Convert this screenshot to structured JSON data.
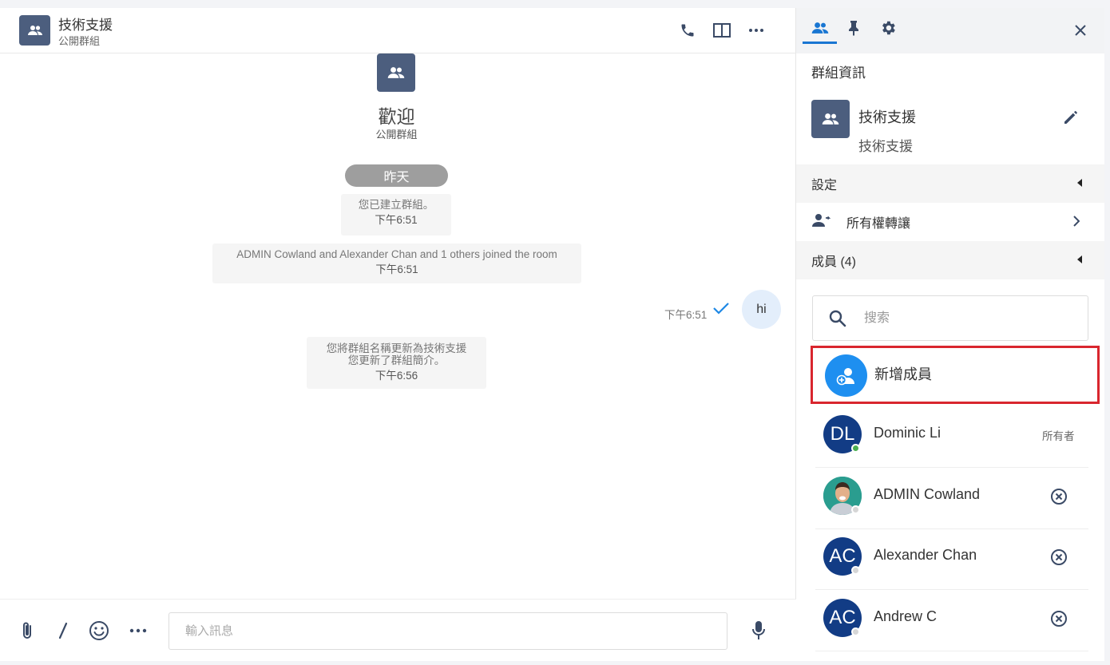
{
  "chat": {
    "header": {
      "title": "技術支援",
      "subtitle": "公開群組",
      "icons": [
        "phone-icon",
        "split-view-icon",
        "more-horizontal-icon"
      ]
    },
    "welcome": {
      "title": "歡迎",
      "subtitle": "公開群組"
    },
    "date_separator": "昨天",
    "system_messages": [
      {
        "lines": [
          "您已建立群組。"
        ],
        "time": "下午6:51"
      },
      {
        "lines": [
          "ADMIN Cowland and Alexander Chan and 1 others joined the room"
        ],
        "time": "下午6:51"
      },
      {
        "lines": [
          "您將群組名稱更新為技術支援",
          "您更新了群組簡介。"
        ],
        "time": "下午6:56"
      }
    ],
    "outgoing": {
      "text": "hi",
      "time": "下午6:51",
      "status": "sent"
    },
    "composer": {
      "placeholder": "輸入訊息",
      "icons": [
        "attach-icon",
        "slash-command-icon",
        "emoji-icon",
        "more-horizontal-icon",
        "microphone-icon"
      ]
    }
  },
  "side": {
    "tabs": [
      "members-icon",
      "pin-icon",
      "gear-icon"
    ],
    "active_tab": "members-icon",
    "group_info_label": "群組資訊",
    "group": {
      "name": "技術支援",
      "description": "技術支援"
    },
    "settings_label": "設定",
    "transfer_label": "所有權轉讓",
    "members_label": "成員 (4)",
    "search_placeholder": "搜索",
    "add_member_label": "新增成員",
    "members": [
      {
        "initials": "DL",
        "name": "Dominic Li",
        "role": "所有者",
        "online": true
      },
      {
        "initials": "",
        "name": "ADMIN Cowland",
        "role": "",
        "online": false,
        "photo": true
      },
      {
        "initials": "AC",
        "name": "Alexander Chan",
        "role": "",
        "online": false
      },
      {
        "initials": "AC",
        "name": "Andrew C",
        "role": "",
        "online": false
      }
    ]
  },
  "colors": {
    "accent": "#1976d2",
    "group_avatar": "#4c5e7e",
    "member_avatar": "#123c85",
    "add_button": "#1e8ff0",
    "highlight": "#d9262e",
    "online": "#4caf50"
  }
}
